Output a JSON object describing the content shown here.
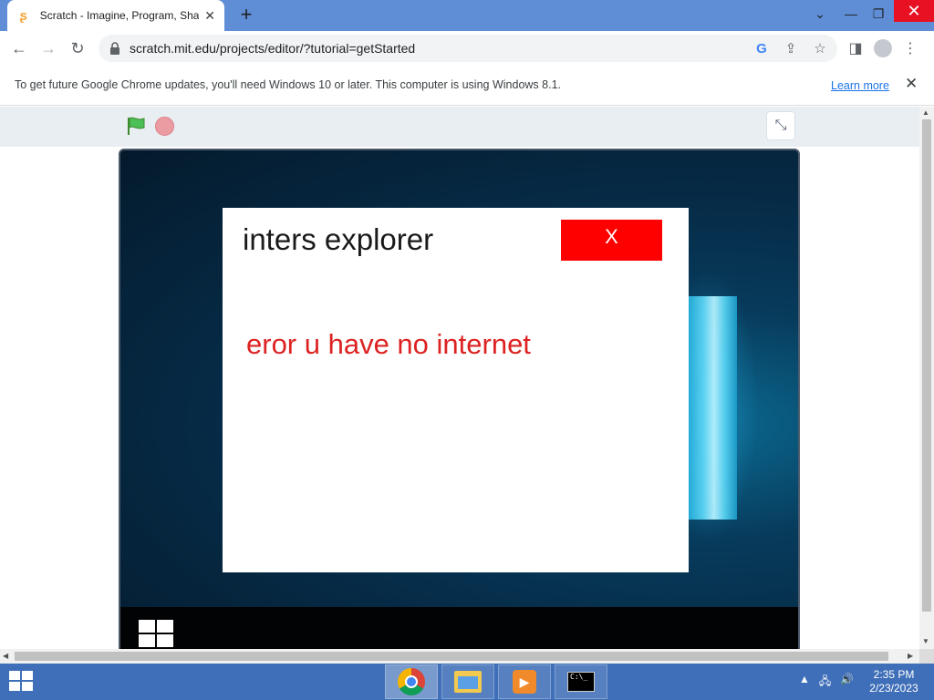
{
  "browser": {
    "tab_title": "Scratch - Imagine, Program, Share",
    "tab_close": "✕",
    "new_tab": "+",
    "url": "scratch.mit.edu/projects/editor/?tutorial=getStarted"
  },
  "infobar": {
    "message": "To get future Google Chrome updates, you'll need Windows 10 or later. This computer is using Windows 8.1.",
    "learn_more": "Learn more",
    "close": "✕"
  },
  "dialog": {
    "title": "inters explorer",
    "close_label": "X",
    "message": "eror u have no internet"
  },
  "taskbar": {
    "time": "2:35 PM",
    "date": "2/23/2023",
    "cmd_text": "C:\\_"
  },
  "colors": {
    "dialog_close": "#ff0000",
    "error_text": "#dd2222",
    "taskbar": "#3f6fb8",
    "tabstrip": "#5f8ed6"
  }
}
